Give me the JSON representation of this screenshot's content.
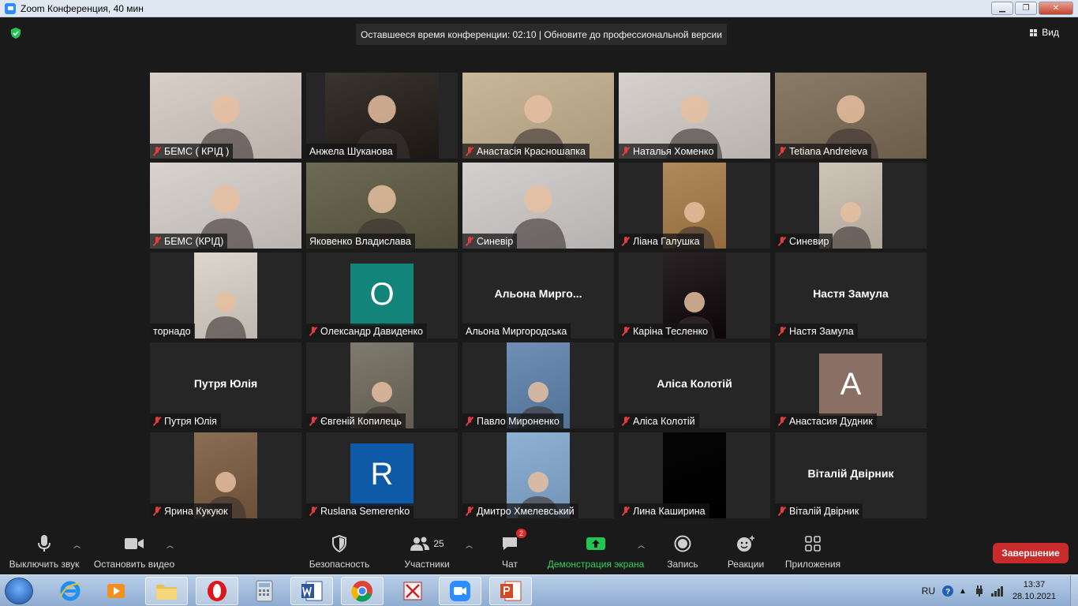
{
  "window": {
    "title": "Zoom Конференция, 40 мин",
    "buttons": [
      "▁",
      "❐",
      "✕"
    ]
  },
  "banner": {
    "text": "Оставшееся время конференции: 02:10 | Обновите до профессиональной версии"
  },
  "view_button": {
    "label": "Вид"
  },
  "participants": [
    {
      "name": "БЕМС ( КРІД )",
      "muted": true,
      "kind": "video",
      "bg": "#d8d0c8"
    },
    {
      "name": "Анжела Шуканова",
      "muted": false,
      "kind": "video-narrow",
      "bg": "#3a3530"
    },
    {
      "name": "Анастасія Красношапка",
      "muted": true,
      "kind": "video",
      "bg": "#c9b79a"
    },
    {
      "name": "Наталья Хоменко",
      "muted": true,
      "kind": "video",
      "bg": "#d6d1cc"
    },
    {
      "name": "Tetiana Andreieva",
      "muted": true,
      "kind": "video",
      "bg": "#8a7a68"
    },
    {
      "name": "БЕМС (КРІД)",
      "muted": true,
      "kind": "video",
      "bg": "#d9d3cf"
    },
    {
      "name": "Яковенко Владислава",
      "muted": false,
      "kind": "video",
      "bg": "#6d6a55",
      "active": true
    },
    {
      "name": "Синевір",
      "muted": true,
      "kind": "video",
      "bg": "#d4d0cf"
    },
    {
      "name": "Ліана Галушка",
      "muted": true,
      "kind": "photo",
      "bg": "#b08a5a"
    },
    {
      "name": "Синевир",
      "muted": true,
      "kind": "photo",
      "bg": "#cfc4b8"
    },
    {
      "name": "торнадо",
      "muted": false,
      "kind": "photo",
      "bg": "#dcd6cc"
    },
    {
      "name": "Олександр Давиденко",
      "muted": true,
      "kind": "avatar",
      "letter": "O",
      "bg": "#12847a"
    },
    {
      "name": "Альона Миргородська",
      "muted": false,
      "kind": "text",
      "big": "Альона  Мирго..."
    },
    {
      "name": "Каріна Тесленко",
      "muted": true,
      "kind": "photo",
      "bg": "#2a2325"
    },
    {
      "name": "Настя Замула",
      "muted": true,
      "kind": "text",
      "big": "Настя Замула"
    },
    {
      "name": "Путря Юлія",
      "muted": true,
      "kind": "text",
      "big": "Путря Юлія"
    },
    {
      "name": "Євгеній Копилець",
      "muted": true,
      "kind": "photo",
      "bg": "#7f7a6e"
    },
    {
      "name": "Павло Мироненко",
      "muted": true,
      "kind": "photo",
      "bg": "#6f8fb5"
    },
    {
      "name": "Аліса Колотій",
      "muted": true,
      "kind": "text",
      "big": "Аліса Колотій"
    },
    {
      "name": "Анастасия Дудник",
      "muted": true,
      "kind": "avatar",
      "letter": "A",
      "bg": "#8a7064"
    },
    {
      "name": "Ярина Кукуюк",
      "muted": true,
      "kind": "photo",
      "bg": "#8a6d55"
    },
    {
      "name": "Ruslana Semerenko",
      "muted": true,
      "kind": "avatar",
      "letter": "R",
      "bg": "#0e5aa7"
    },
    {
      "name": "Дмитро Хмелевський",
      "muted": true,
      "kind": "photo",
      "bg": "#8fb1d4"
    },
    {
      "name": "Лина Каширина",
      "muted": true,
      "kind": "photo",
      "bg": "#050505"
    },
    {
      "name": "Віталій Двірник",
      "muted": true,
      "kind": "text",
      "big": "Віталій Двірник"
    }
  ],
  "toolbar": {
    "mute": "Выключить звук",
    "video": "Остановить видео",
    "security": "Безопасность",
    "participants": "Участники",
    "participants_count": "25",
    "chat": "Чат",
    "chat_badge": "2",
    "share": "Демонстрация экрана",
    "record": "Запись",
    "reactions": "Реакции",
    "apps": "Приложения",
    "end": "Завершение"
  },
  "taskbar": {
    "lang": "RU",
    "time": "13:37",
    "date": "28.10.2021"
  },
  "colors": {
    "accent_green": "#2ed160",
    "end_red": "#c92a2a",
    "active_speaker": "#e8e07a",
    "muted_red": "#e23c3c"
  }
}
